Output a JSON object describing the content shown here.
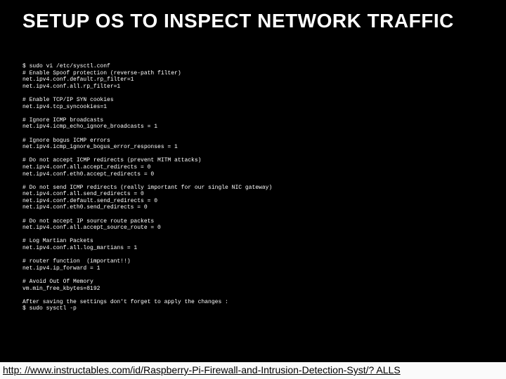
{
  "title": "SETUP OS TO INSPECT NETWORK TRAFFIC",
  "code": "$ sudo vi /etc/sysctl.conf\n# Enable Spoof protection (reverse-path filter)\nnet.ipv4.conf.default.rp_filter=1\nnet.ipv4.conf.all.rp_filter=1\n\n# Enable TCP/IP SYN cookies\nnet.ipv4.tcp_syncookies=1\n\n# Ignore ICMP broadcasts\nnet.ipv4.icmp_echo_ignore_broadcasts = 1\n\n# Ignore bogus ICMP errors\nnet.ipv4.icmp_ignore_bogus_error_responses = 1\n\n# Do not accept ICMP redirects (prevent MITM attacks)\nnet.ipv4.conf.all.accept_redirects = 0\nnet.ipv4.conf.eth0.accept_redirects = 0\n\n# Do not send ICMP redirects (really important for our single NIC gateway)\nnet.ipv4.conf.all.send_redirects = 0\nnet.ipv4.conf.default.send_redirects = 0\nnet.ipv4.conf.eth0.send_redirects = 0\n\n# Do not accept IP source route packets\nnet.ipv4.conf.all.accept_source_route = 0\n\n# Log Martian Packets\nnet.ipv4.conf.all.log_martians = 1\n\n# router function  (important!!)\nnet.ipv4.ip_forward = 1\n\n# Avoid Out Of Memory\nvm.min_free_kbytes=8192\n\nAfter saving the settings don't forget to apply the changes :\n$ sudo sysctl -p",
  "footer_link": "http: //www.instructables.com/id/Raspberry-Pi-Firewall-and-Intrusion-Detection-Syst/? ALLS"
}
